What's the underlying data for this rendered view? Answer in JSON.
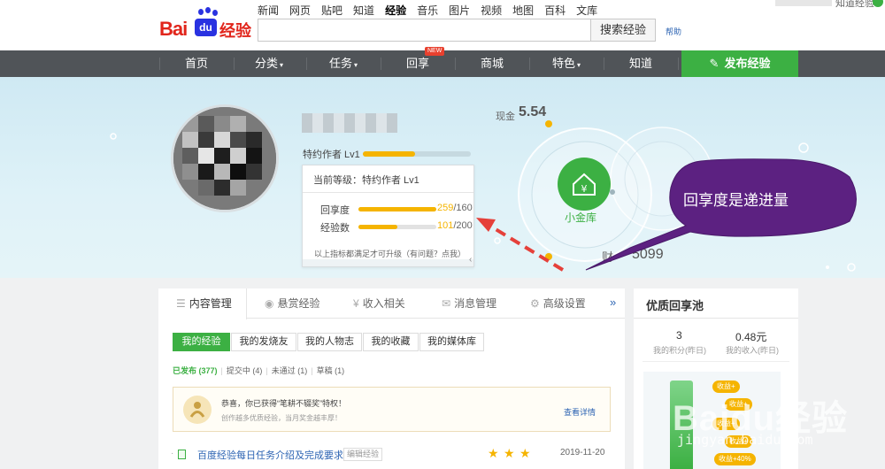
{
  "header": {
    "logo": {
      "bai": "Bai",
      "du": "du",
      "cn": "经验"
    },
    "products": [
      "新闻",
      "网页",
      "贴吧",
      "知道",
      "经验",
      "音乐",
      "图片",
      "视频",
      "地图",
      "百科",
      "文库"
    ],
    "current_product": "经验",
    "search": {
      "value": "",
      "button": "搜索经验"
    },
    "help": "帮助",
    "user_text": "知道经验"
  },
  "nav": {
    "items": [
      "首页",
      "分类",
      "任务",
      "回享",
      "商城",
      "特色",
      "知道"
    ],
    "new_badge": "NEW",
    "publish": "发布经验"
  },
  "profile": {
    "level_label": "特约作者 Lv1",
    "level_progress": 0.48,
    "panel": {
      "current": "当前等级：特约作者 Lv1",
      "rows": [
        {
          "label": "回享度",
          "current": "259",
          "target": "/160",
          "progress": 1.0
        },
        {
          "label": "经验数",
          "current": "101",
          "target": "/200",
          "progress": 0.5
        }
      ],
      "note": "以上指标都满足才可升级（有问题？点我）"
    }
  },
  "wallet": {
    "cash_label": "现金",
    "cash_value": "5.54",
    "vault_label": "小金库",
    "treasure_label": "财",
    "treasure_value": "5099"
  },
  "callout": {
    "text": "回享度是递进量"
  },
  "content": {
    "tabs": [
      "内容管理",
      "悬赏经验",
      "收入相关",
      "消息管理",
      "高级设置"
    ],
    "more": "»",
    "subtabs": [
      "我的经验",
      "我的发烧友",
      "我的人物志",
      "我的收藏",
      "我的媒体库"
    ],
    "filters": {
      "published": "已发布 (377)",
      "items": [
        "提交中 (4)",
        "未通过 (1)",
        "草稿 (1)"
      ]
    },
    "award": {
      "title": "恭喜，你已获得“笔耕不辍奖”特权！",
      "subtitle": "创作越多优质经验，当月奖金越丰厚！",
      "link": "查看详情"
    },
    "article": {
      "title": "百度经验每日任务介绍及完成要求",
      "edit": "编辑经验",
      "stars": 3,
      "date": "2019-11-20"
    }
  },
  "right_panel": {
    "title": "优质回享池",
    "stats": [
      {
        "value": "3",
        "label": "我的积分(昨日)"
      },
      {
        "value": "0.48元",
        "label": "我的收入(昨日)"
      }
    ],
    "pool_tags": [
      "收益+",
      "收益+",
      "收益+",
      "收益+",
      "收益+40%"
    ]
  },
  "watermark": {
    "main": "Baidu经验",
    "sub": "jingyan.baidu.com"
  },
  "colors": {
    "accent": "#3cb043",
    "nav_bg": "#505458",
    "link": "#2d64b3",
    "callout": "#5c2181",
    "arrow": "#e5403a",
    "progress": "#f5b400"
  }
}
